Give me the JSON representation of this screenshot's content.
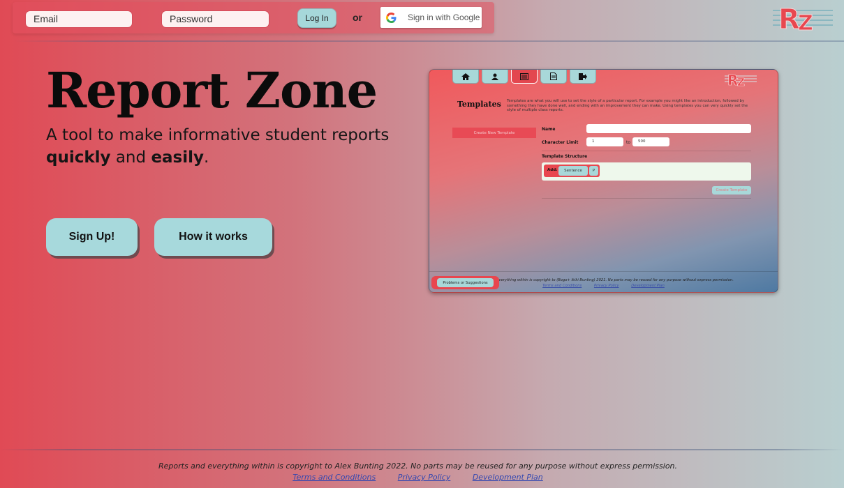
{
  "login": {
    "email_placeholder": "Email",
    "password_placeholder": "Password",
    "login_label": "Log In",
    "or_label": "or",
    "google_label": "Sign in with Google"
  },
  "hero": {
    "title": "Report Zone",
    "subtitle_line1": "A tool to make informative student reports",
    "subtitle_word1": "quickly",
    "subtitle_and": " and ",
    "subtitle_word2": "easily",
    "subtitle_end": ".",
    "signup_label": "Sign Up!",
    "how_label": "How it works"
  },
  "preview": {
    "tabs": [
      "home-icon",
      "users-icon",
      "templates-icon",
      "document-icon",
      "logout-icon"
    ],
    "heading": "Templates",
    "description": "Templates are what you will use to set the style of a particular report. For example you might like an introduction, followed by something they have done well, and ending with an improvement they can make. Using templates you can very quickly set the style of multiple class reports.",
    "create_new_label": "Create New Template",
    "name_label": "Name",
    "char_limit_label": "Character Limit",
    "char_min": "1",
    "to_label": "to",
    "char_max": "500",
    "structure_label": "Template Structure",
    "add_label": "Add:",
    "chip_sentence": "Sentence",
    "chip_p": "P",
    "create_template_label": "Create Template",
    "copyright": "Reports and everything within is copyright to (Bogo+ ikiki Bunting) 2021. No parts may be reused for any purpose without express permission.",
    "links": [
      "Terms and Conditions",
      "Privacy Policy",
      "Development Plan"
    ],
    "problems_label": "Problems or Suggestions"
  },
  "footer": {
    "copyright": "Reports and everything within is copyright to Alex Bunting 2022. No parts may be reused for any purpose without express permission.",
    "terms": "Terms and Conditions",
    "privacy": "Privacy Policy",
    "devplan": "Development Plan"
  },
  "colors": {
    "accent_red": "#e8474f",
    "accent_teal": "#a8d8d9"
  }
}
